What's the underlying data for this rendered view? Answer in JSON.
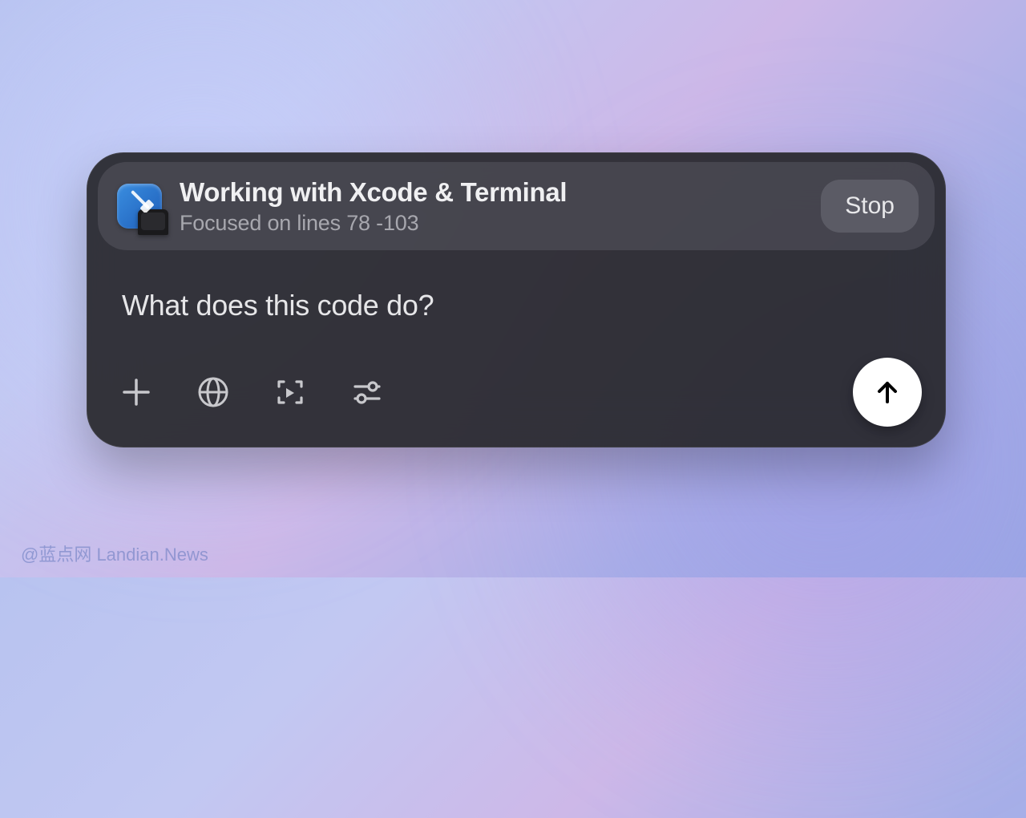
{
  "header": {
    "title": "Working with Xcode & Terminal",
    "subtitle": "Focused on lines 78 -103",
    "stop_label": "Stop"
  },
  "prompt": {
    "text": "What does this code do?"
  },
  "toolbar": {
    "icons": [
      "plus",
      "globe",
      "capture",
      "sliders"
    ]
  },
  "watermark": "@蓝点网 Landian.News"
}
